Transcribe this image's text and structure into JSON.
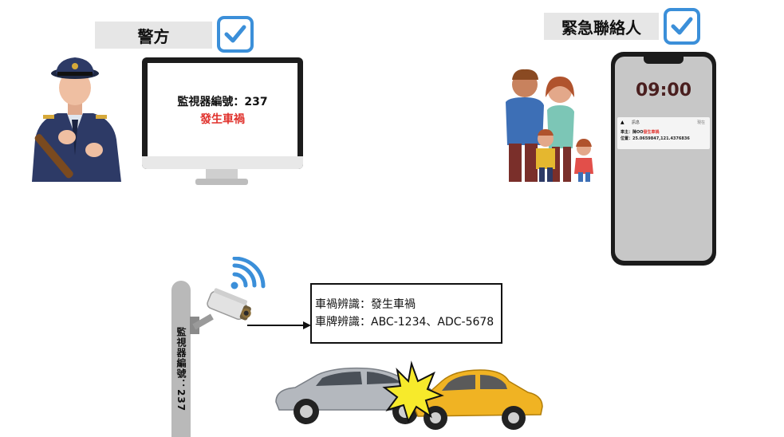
{
  "police": {
    "label": "警方",
    "monitor_id_text": "監視器編號：237",
    "accident_text": "發生車禍"
  },
  "emergency_contact": {
    "label": "緊急聯絡人",
    "phone_time": "09:00",
    "notification_app": "訊息",
    "notification_action": "現在",
    "notification_line1_prefix": "車主：陳OO",
    "notification_line1_alert": "發生車禍",
    "notification_line2": "位置：25.0659847,121.4376836"
  },
  "camera": {
    "pole_text": "監視器編號：237"
  },
  "recognition_box": {
    "line1": "車禍辨識：發生車禍",
    "line2": "車牌辨識：ABC-1234、ADC-5678"
  },
  "colors": {
    "check_blue": "#3b8fd9",
    "alert_red": "#e0302b"
  }
}
